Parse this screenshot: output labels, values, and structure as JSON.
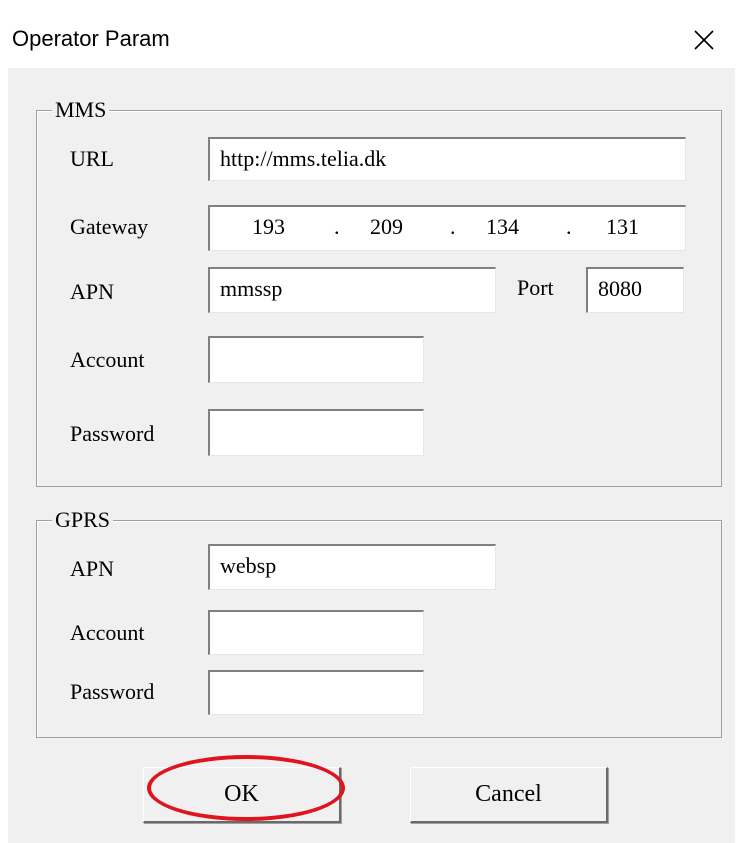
{
  "window": {
    "title": "Operator Param",
    "close_icon": "close-icon"
  },
  "mms": {
    "group_label": "MMS",
    "url_label": "URL",
    "url_value": "http://mms.telia.dk",
    "gateway_label": "Gateway",
    "gateway_octets": [
      "193",
      "209",
      "134",
      "131"
    ],
    "gateway_separator": ".",
    "apn_label": "APN",
    "apn_value": "mmssp",
    "port_label": "Port",
    "port_value": "8080",
    "account_label": "Account",
    "account_value": "",
    "password_label": "Password",
    "password_value": ""
  },
  "gprs": {
    "group_label": "GPRS",
    "apn_label": "APN",
    "apn_value": "websp",
    "account_label": "Account",
    "account_value": "",
    "password_label": "Password",
    "password_value": ""
  },
  "buttons": {
    "ok_label": "OK",
    "cancel_label": "Cancel"
  },
  "colors": {
    "dialog_bg": "#f0f0f0",
    "highlight": "#e0141e"
  }
}
